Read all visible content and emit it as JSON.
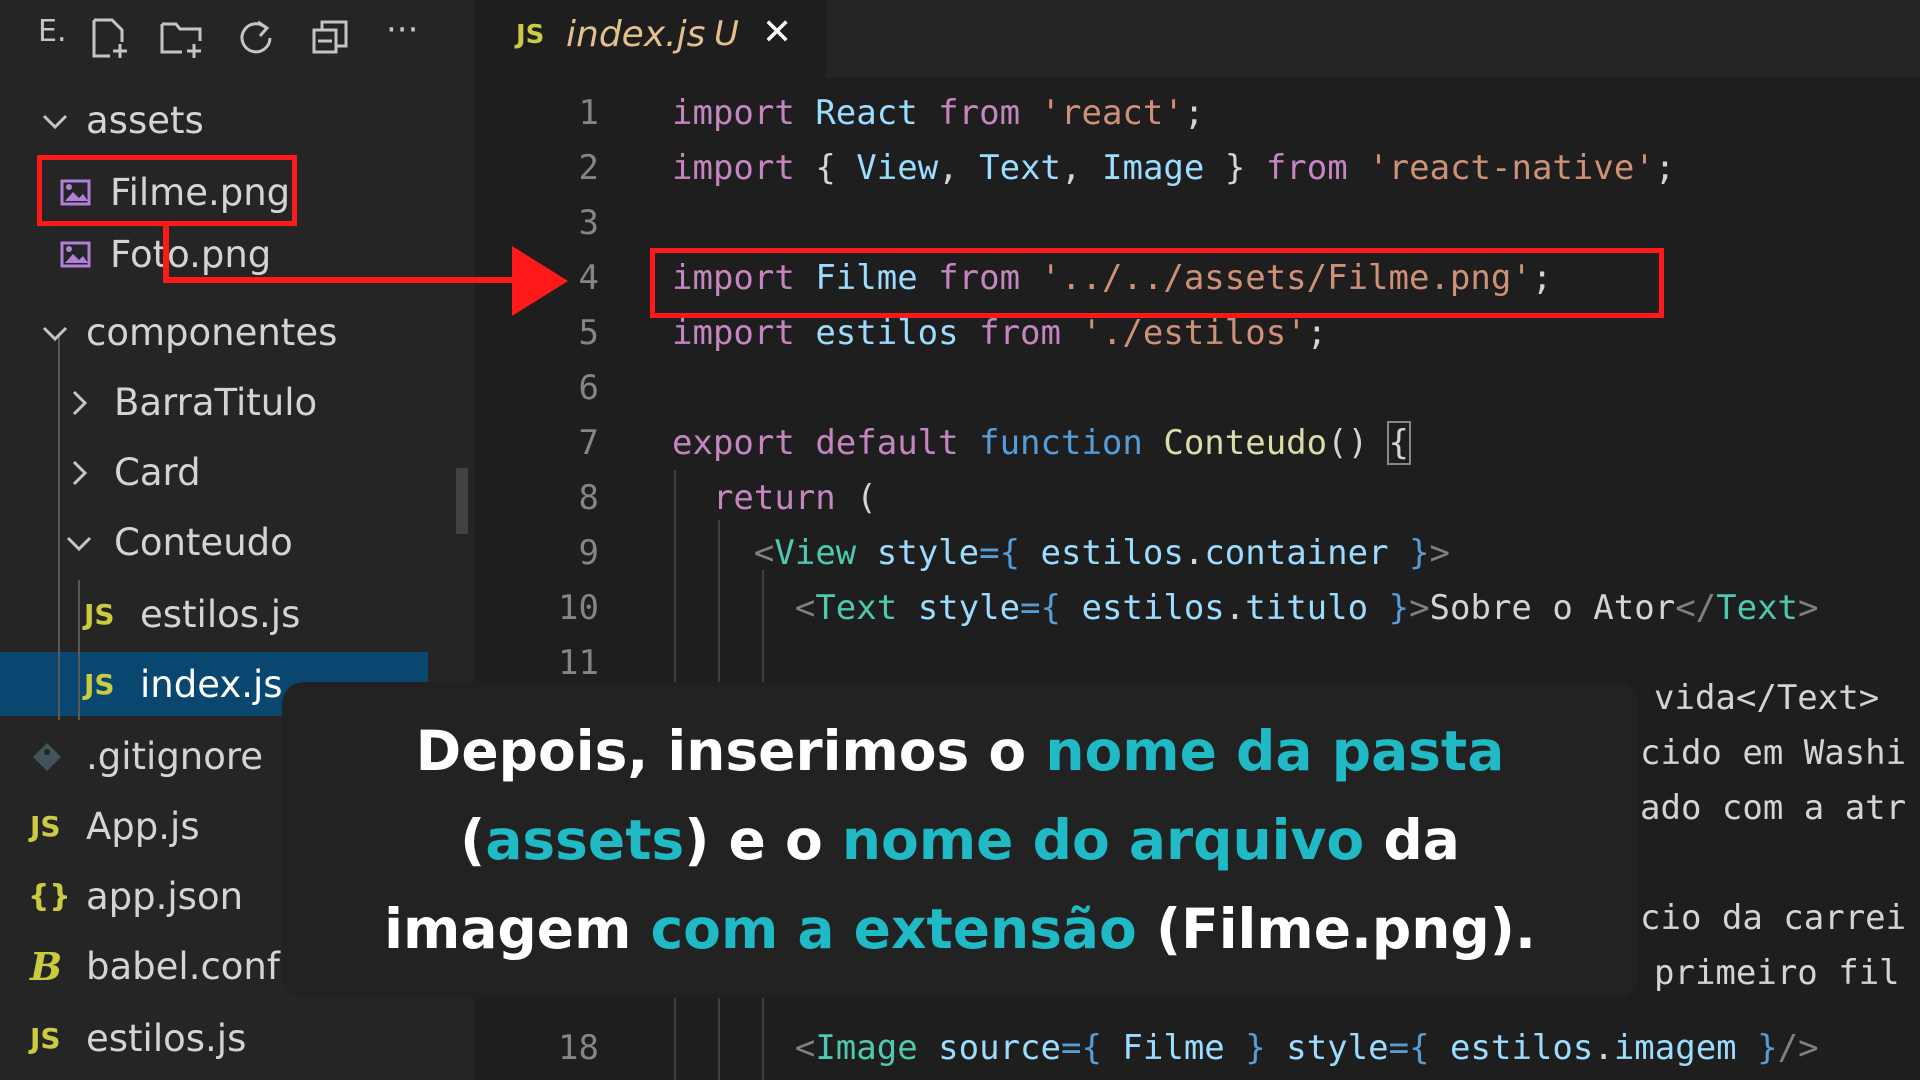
{
  "explorer": {
    "label": "E.",
    "toolbar_icons": [
      "new-file-icon",
      "new-folder-icon",
      "refresh-icon",
      "collapse-all-icon",
      "more-icon"
    ],
    "toolbar_more": "···",
    "tree": [
      {
        "label": "assets",
        "type": "folder",
        "expanded": true
      },
      {
        "label": "Filme.png",
        "type": "image"
      },
      {
        "label": "Foto.png",
        "type": "image"
      },
      {
        "label": "componentes",
        "type": "folder",
        "expanded": true
      },
      {
        "label": "BarraTitulo",
        "type": "folder",
        "expanded": false
      },
      {
        "label": "Card",
        "type": "folder",
        "expanded": false
      },
      {
        "label": "Conteudo",
        "type": "folder",
        "expanded": true
      },
      {
        "label": "estilos.js",
        "type": "js"
      },
      {
        "label": "index.js",
        "type": "js",
        "selected": true
      },
      {
        "label": ".gitignore",
        "type": "git"
      },
      {
        "label": "App.js",
        "type": "js"
      },
      {
        "label": "app.json",
        "type": "json"
      },
      {
        "label": "babel.conf",
        "type": "babel"
      },
      {
        "label": "estilos.js",
        "type": "js"
      }
    ],
    "js_badge": "JS",
    "json_badge": "{}",
    "babel_badge": "B"
  },
  "tab": {
    "badge": "JS",
    "filename": "index.js",
    "status": "U",
    "close": "✕"
  },
  "editor": {
    "line_numbers": [
      "1",
      "2",
      "3",
      "4",
      "5",
      "6",
      "7",
      "8",
      "9",
      "10",
      "11",
      "18"
    ],
    "lines": {
      "l1": [
        "import",
        "React",
        "from",
        "'react'",
        ";"
      ],
      "l2": [
        "import",
        "{",
        "View",
        ",",
        "Text",
        ",",
        "Image",
        "}",
        "from",
        "'react-native'",
        ";"
      ],
      "l4": [
        "import",
        "Filme",
        "from",
        "'../../assets/Filme.png'",
        ";"
      ],
      "l5": [
        "import",
        "estilos",
        "from",
        "'./estilos'",
        ";"
      ],
      "l7": [
        "export",
        "default",
        "function",
        "Conteudo",
        "()",
        "{"
      ],
      "l8": [
        "return",
        "("
      ],
      "l9": [
        "<",
        "View",
        "style",
        "={",
        "estilos",
        ".",
        "container",
        "}",
        ">"
      ],
      "l10": [
        "<",
        "Text",
        "style",
        "={",
        "estilos",
        ".",
        "titulo",
        "}",
        ">",
        "Sobre o Ator",
        "</",
        "Text",
        ">"
      ],
      "l18": [
        "<",
        "Image",
        "source",
        "={",
        "Filme",
        "}",
        "style",
        "={",
        "estilos",
        ".",
        "imagem",
        "}",
        "/>"
      ]
    },
    "partial_lines": [
      "vida</Text>",
      "cido em Washi",
      "ado com a atr",
      "cio da carrei",
      "primeiro fil"
    ]
  },
  "caption": {
    "p1": "Depois, inserimos o ",
    "h1": "nome da pasta",
    "p2": "(",
    "h2": "assets",
    "p3": ") e o ",
    "h3": "nome do arquivo",
    "p4": " da",
    "p5": "imagem ",
    "h4": "com a extensão",
    "p6": " (Filme.png)."
  },
  "colors": {
    "highlight": "#1fbac6",
    "annotation": "#ff1a1a",
    "selection": "#094771"
  }
}
